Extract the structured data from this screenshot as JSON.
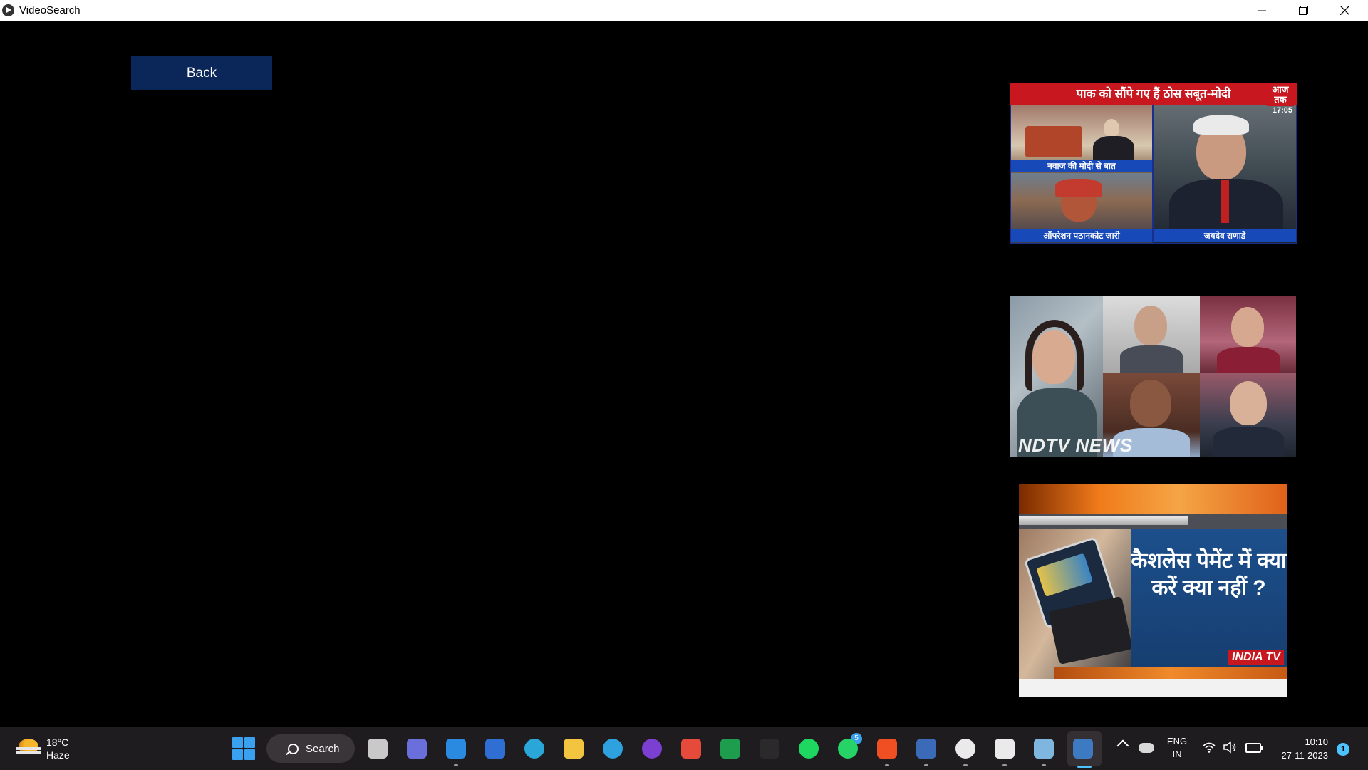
{
  "window": {
    "title": "VideoSearch"
  },
  "content": {
    "back_label": "Back",
    "thumbnails": [
      {
        "headline": "पाक को सौंपे गए हैं ठोस सबूत-मोदी",
        "channel_logo": "आज तक",
        "time": "17:05",
        "captions": [
          "नवाज की मोदी से बात",
          "ऑपरेशन पठानकोट जारी",
          "जयदेव राणाडे"
        ]
      },
      {
        "channel_logo": "NDTV NEWS"
      },
      {
        "text": "कैशलेस पेमेंट में क्या करें क्या नहीं ?",
        "channel_logo": "INDIA TV"
      }
    ]
  },
  "taskbar": {
    "weather": {
      "temp": "18°C",
      "condition": "Haze"
    },
    "search_label": "Search",
    "whatsapp_badge": "5",
    "language": {
      "line1": "ENG",
      "line2": "IN"
    },
    "clock": {
      "time": "10:10",
      "date": "27-11-2023"
    },
    "notification_count": "1",
    "apps": [
      {
        "name": "task-view",
        "color": "#c9c9c9"
      },
      {
        "name": "teams",
        "color": "#6b6fdc"
      },
      {
        "name": "vscode",
        "color": "#2a8ae0"
      },
      {
        "name": "microsoft-store",
        "color": "#2f6fd3"
      },
      {
        "name": "edge",
        "color": "#2aa7d8"
      },
      {
        "name": "file-explorer",
        "color": "#f2c440"
      },
      {
        "name": "telegram",
        "color": "#2ea2de"
      },
      {
        "name": "podcasts",
        "color": "#7b3fd1"
      },
      {
        "name": "gmail",
        "color": "#e64a3b"
      },
      {
        "name": "classroom",
        "color": "#1e9d4e"
      },
      {
        "name": "dark-app",
        "color": "#2a2a2a"
      },
      {
        "name": "spotify",
        "color": "#1ed760"
      },
      {
        "name": "whatsapp",
        "color": "#25d366"
      },
      {
        "name": "brave",
        "color": "#f04e23"
      },
      {
        "name": "editor",
        "color": "#3a6ab8"
      },
      {
        "name": "green-app",
        "color": "#eaeaea"
      },
      {
        "name": "terminal-app",
        "color": "#eaeaea"
      },
      {
        "name": "snipping-tool",
        "color": "#7fb6e0"
      },
      {
        "name": "python",
        "color": "#3d7ac1"
      }
    ]
  }
}
